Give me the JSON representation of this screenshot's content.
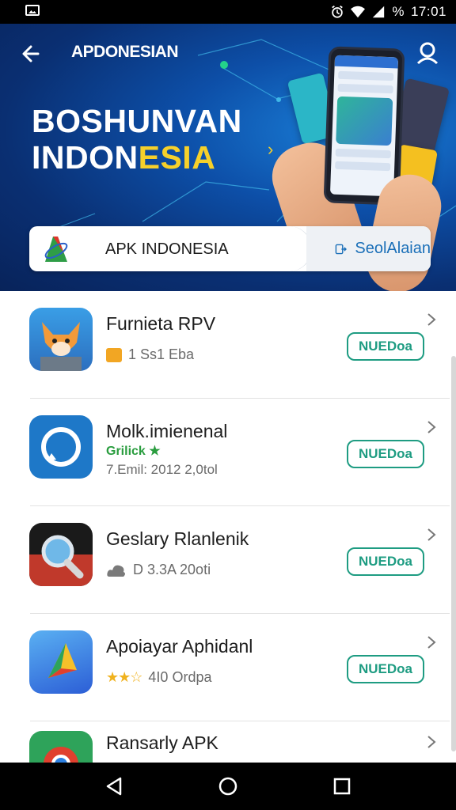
{
  "status_bar": {
    "time": "17:01",
    "battery_text": "%"
  },
  "header": {
    "brand": "APDONESIAN",
    "hero_title_line1": "BOSHUNVAN",
    "hero_title_line2_white": "INDON",
    "hero_title_line2_yellow": "ESIA"
  },
  "search": {
    "placeholder": "APK INDONESIA",
    "action_label": "SeolAlaian"
  },
  "apps": [
    {
      "title": "Furnieta RPV",
      "meta": "1  Ss1 Eba",
      "button": "NUEDoa"
    },
    {
      "title": "Molk.imienenal",
      "sub": "Grilick",
      "meta": "7.Emil: 2012 2,0tol",
      "button": "NUEDoa"
    },
    {
      "title": "Geslary Rlanlenik",
      "meta": "D 3.3A 20oti",
      "button": "NUEDoa"
    },
    {
      "title": "Apoiayar Aphidanl",
      "meta": "4I0 Ordpa",
      "button": "NUEDoa"
    },
    {
      "title": "Ransarly APK",
      "meta": "",
      "button": ""
    }
  ],
  "colors": {
    "accent": "#1e9c82",
    "hero_bg": "#0a2f72",
    "highlight": "#f6d02a",
    "brand_red": "#e0352b"
  },
  "icons": {
    "back": "arrow-left-icon",
    "account": "account-icon",
    "search_action": "open-app-icon",
    "nav_back": "triangle-back-icon",
    "nav_home": "circle-home-icon",
    "nav_recents": "square-recents-icon"
  }
}
